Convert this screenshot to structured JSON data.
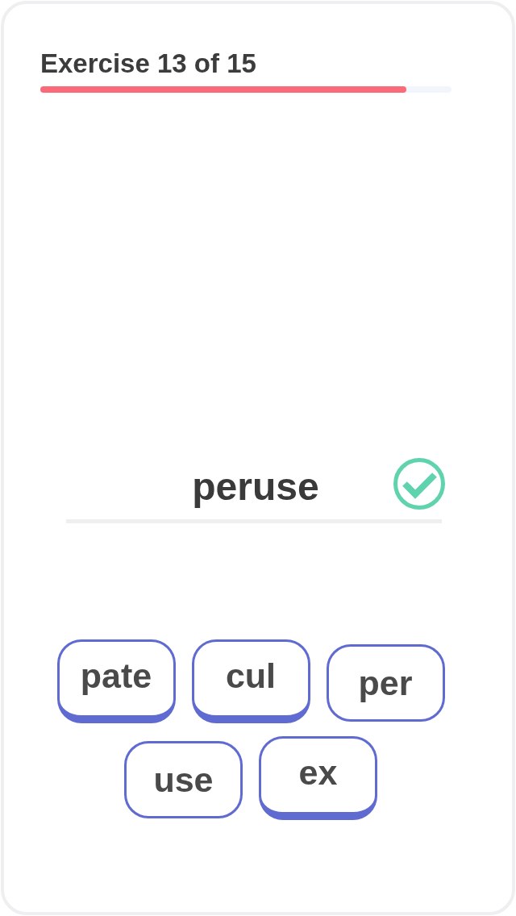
{
  "header": {
    "title": "Exercise 13 of 15",
    "progress": {
      "level": 0.89
    }
  },
  "answer": {
    "text": "peruse",
    "correct": true
  },
  "tiles": [
    {
      "label": "pate",
      "selected": false
    },
    {
      "label": "cul",
      "selected": false
    },
    {
      "label": "per",
      "selected": true
    },
    {
      "label": "use",
      "selected": true
    },
    {
      "label": "ex",
      "selected": false
    }
  ]
}
